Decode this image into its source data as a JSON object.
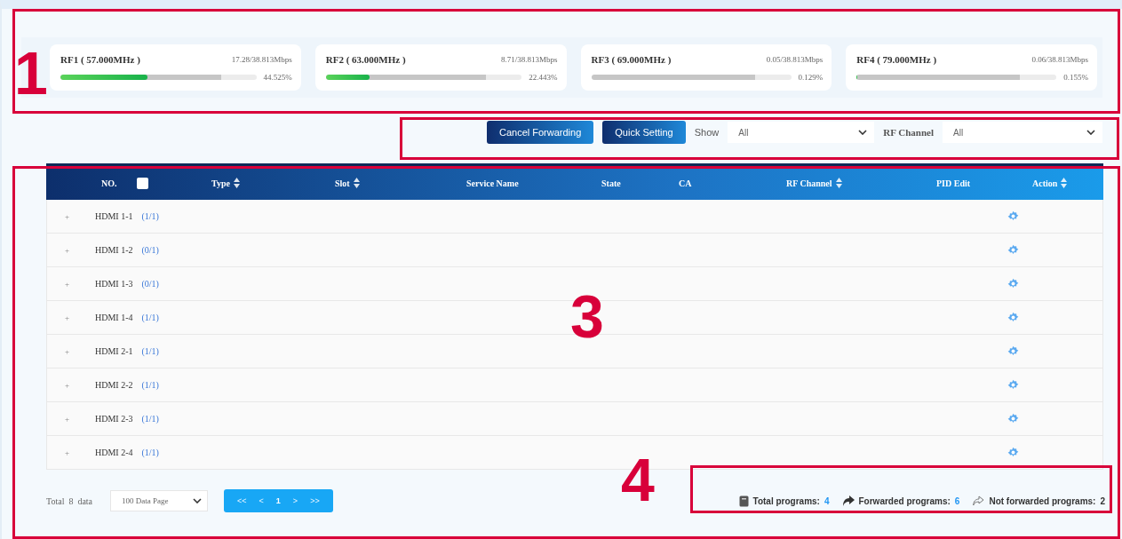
{
  "rf_cards": [
    {
      "name": "RF1 ( 57.000MHz )",
      "rate": "17.28/38.813Mbps",
      "level": 0.445,
      "percent": "44.525%"
    },
    {
      "name": "RF2 ( 63.000MHz )",
      "rate": "8.71/38.813Mbps",
      "level": 0.224,
      "percent": "22.443%"
    },
    {
      "name": "RF3 ( 69.000MHz )",
      "rate": "0.05/38.813Mbps",
      "level": 0.001,
      "percent": "0.129%"
    },
    {
      "name": "RF4 ( 79.000MHz )",
      "rate": "0.06/38.813Mbps",
      "level": 0.002,
      "percent": "0.155%"
    }
  ],
  "toolbar": {
    "cancel_button": "Cancel Forwarding",
    "quick_button": "Quick Setting",
    "show_label": "Show",
    "show_value": "All",
    "rf_label": "RF Channel",
    "rf_value": "All"
  },
  "table": {
    "columns": [
      {
        "label": "NO.",
        "checked": false
      },
      {
        "label": "Type",
        "sortable": true
      },
      {
        "label": "Slot",
        "sortable": true
      },
      {
        "label": "Service Name"
      },
      {
        "label": "State"
      },
      {
        "label": "CA"
      },
      {
        "label": "RF Channel",
        "sortable": true
      },
      {
        "label": "PID Edit"
      },
      {
        "label": "Action",
        "sortable": true
      }
    ],
    "rows": [
      {
        "expander": "+",
        "name": "HDMI 1-1",
        "count": "(1/1)"
      },
      {
        "expander": "+",
        "name": "HDMI 1-2",
        "count": "(0/1)"
      },
      {
        "expander": "+",
        "name": "HDMI 1-3",
        "count": "(0/1)"
      },
      {
        "expander": "+",
        "name": "HDMI 1-4",
        "count": "(1/1)"
      },
      {
        "expander": "+",
        "name": "HDMI 2-1",
        "count": "(1/1)"
      },
      {
        "expander": "+",
        "name": "HDMI 2-2",
        "count": "(1/1)"
      },
      {
        "expander": "+",
        "name": "HDMI 2-3",
        "count": "(1/1)"
      },
      {
        "expander": "+",
        "name": "HDMI 2-4",
        "count": "(1/1)"
      }
    ]
  },
  "footer": {
    "total": "Total  8  data",
    "page_size": "100 Data Page",
    "pager": [
      {
        "label": "<<",
        "selected": false
      },
      {
        "label": "<",
        "selected": false
      },
      {
        "label": "1",
        "selected": true
      },
      {
        "label": ">",
        "selected": false
      },
      {
        "label": ">>",
        "selected": false
      }
    ],
    "stats": [
      {
        "kind": "total",
        "label": "Total programs:",
        "value": "4",
        "color": "#2196f3"
      },
      {
        "kind": "forwarded",
        "label": "Forwarded programs:",
        "value": "6",
        "color": "#2196f3"
      },
      {
        "kind": "not_forwarded",
        "label": "Not forwarded programs:",
        "value": "2",
        "color": "#333333"
      }
    ]
  },
  "annotations": [
    {
      "label": "1"
    },
    {
      "label": "3"
    },
    {
      "label": "4"
    }
  ]
}
